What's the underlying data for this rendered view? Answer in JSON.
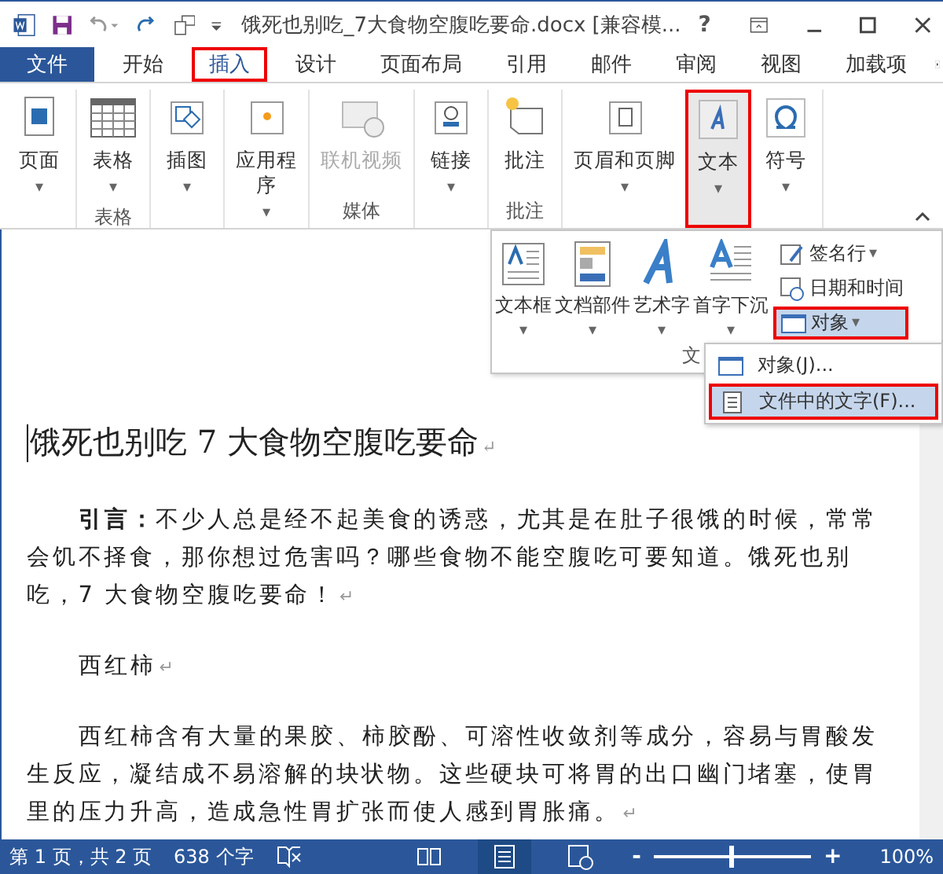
{
  "title_bar": {
    "title": "饿死也别吃_7大食物空腹吃要命.docx [兼容模...",
    "help": "?"
  },
  "tabs": [
    {
      "label": "文件",
      "kind": "file",
      "selected": false,
      "annotated": false
    },
    {
      "label": "开始",
      "kind": "tab",
      "selected": false,
      "annotated": false
    },
    {
      "label": "插入",
      "kind": "tab",
      "selected": true,
      "annotated": true
    },
    {
      "label": "设计",
      "kind": "tab",
      "selected": false,
      "annotated": false
    },
    {
      "label": "页面布局",
      "kind": "tab",
      "selected": false,
      "annotated": false
    },
    {
      "label": "引用",
      "kind": "tab",
      "selected": false,
      "annotated": false
    },
    {
      "label": "邮件",
      "kind": "tab",
      "selected": false,
      "annotated": false
    },
    {
      "label": "审阅",
      "kind": "tab",
      "selected": false,
      "annotated": false
    },
    {
      "label": "视图",
      "kind": "tab",
      "selected": false,
      "annotated": false
    },
    {
      "label": "加载项",
      "kind": "tab",
      "selected": false,
      "annotated": false
    }
  ],
  "ribbon": {
    "groups": [
      {
        "buttons": [
          {
            "label": "页面",
            "arrow": "▾",
            "disabled": false,
            "selected": false,
            "annotated": false
          }
        ]
      },
      {
        "label": "表格",
        "buttons": [
          {
            "label": "表格",
            "arrow": "▾",
            "disabled": false,
            "selected": false,
            "annotated": false
          }
        ]
      },
      {
        "buttons": [
          {
            "label": "插图",
            "arrow": "▾",
            "disabled": false,
            "selected": false,
            "annotated": false
          }
        ]
      },
      {
        "buttons": [
          {
            "label": "应用程",
            "label2": "序",
            "arrow": "▾",
            "disabled": false,
            "selected": false,
            "annotated": false
          }
        ]
      },
      {
        "label": "媒体",
        "buttons": [
          {
            "label": "联机视频",
            "disabled": true,
            "selected": false,
            "annotated": false
          }
        ]
      },
      {
        "buttons": [
          {
            "label": "链接",
            "arrow": "▾",
            "disabled": false,
            "selected": false,
            "annotated": false
          }
        ]
      },
      {
        "label": "批注",
        "buttons": [
          {
            "label": "批注",
            "disabled": false,
            "selected": false,
            "annotated": false
          }
        ]
      },
      {
        "buttons": [
          {
            "label": "页眉和页脚",
            "arrow": "▾",
            "disabled": false,
            "selected": false,
            "annotated": false
          },
          {
            "label": "文本",
            "arrow": "▾",
            "disabled": false,
            "selected": true,
            "annotated": true
          },
          {
            "label": "符号",
            "arrow": "▾",
            "disabled": false,
            "selected": false,
            "annotated": false
          }
        ]
      }
    ]
  },
  "text_panel": {
    "large": [
      {
        "label": "文本框",
        "arrow": "▾"
      },
      {
        "label": "文档部件",
        "arrow": "▾"
      },
      {
        "label": "艺术字",
        "arrow": "▾"
      },
      {
        "label": "首字下沉",
        "arrow": "▾"
      }
    ],
    "small": [
      {
        "label": "签名行",
        "arrow": "▾",
        "selected": false,
        "annotated": false
      },
      {
        "label": "日期和时间",
        "selected": false,
        "annotated": false
      },
      {
        "label": "对象",
        "arrow": "▾",
        "selected": true,
        "annotated": true
      }
    ],
    "group_label": "文"
  },
  "submenu": [
    {
      "label": "对象(J)...",
      "selected": false,
      "annotated": false
    },
    {
      "label": "文件中的文字(F)...",
      "selected": true,
      "annotated": true
    }
  ],
  "document": {
    "heading": {
      "text": "饿死也别吃 7 大食物空腹吃要命",
      "mark": "↵"
    },
    "paragraphs": [
      {
        "text": "**引言：**不少人总是经不起美食的诱惑，尤其是在肚子很饿的时候，常常会饥不择食，那你想过危害吗？哪些食物不能空腹吃可要知道。饿死也别吃，7 大食物空腹吃要命！",
        "mark": "↵"
      },
      {
        "text": "西红柿",
        "mark": "↵"
      },
      {
        "text": "西红柿含有大量的果胶、柿胶酚、可溶性收敛剂等成分，容易与胃酸发生反应，凝结成不易溶解的块状物。这些硬块可将胃的出口幽门堵塞，使胃里的压力升高，造成急性胃扩张而使人感到胃胀痛。",
        "mark": "↵"
      }
    ]
  },
  "status_bar": {
    "page": "第 1 页，共 2 页",
    "words": "638 个字",
    "views": [
      {
        "selected": false
      },
      {
        "selected": true
      },
      {
        "selected": false
      }
    ],
    "zoom": {
      "minus": "-",
      "level": 0.49,
      "plus": "+",
      "reading": "100%"
    }
  }
}
